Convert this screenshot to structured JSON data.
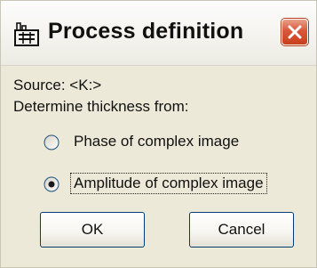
{
  "window": {
    "title": "Process definition"
  },
  "icons": {
    "app": "process-app-icon",
    "close": "close-icon"
  },
  "colors": {
    "dialog_background": "#ece9d8",
    "close_button": "#d8583a",
    "button_border": "#003c74"
  },
  "content": {
    "source_line": "Source:  <K:>",
    "thickness_prompt": "Determine thickness from:"
  },
  "options": [
    {
      "label": "Phase of complex image",
      "selected": false
    },
    {
      "label": "Amplitude of complex image",
      "selected": true
    }
  ],
  "buttons": {
    "ok": "OK",
    "cancel": "Cancel"
  }
}
